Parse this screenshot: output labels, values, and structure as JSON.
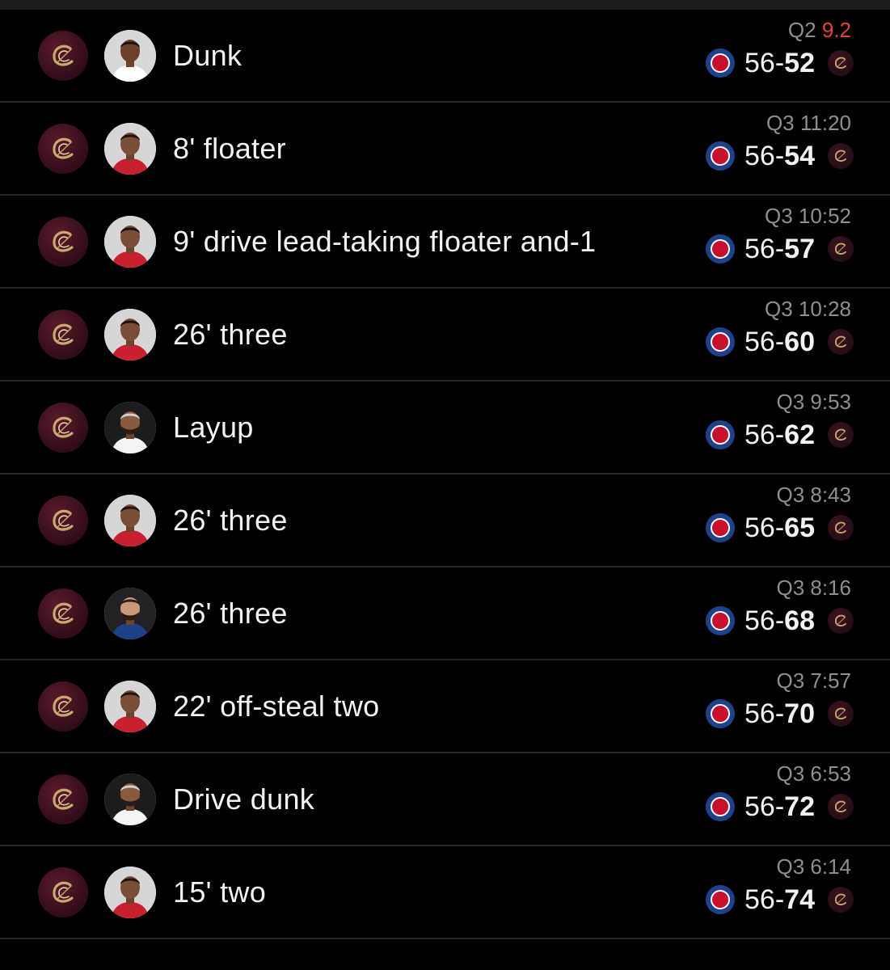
{
  "plays": [
    {
      "team_icon": "cavaliers-logo",
      "player_avatar": "player-a",
      "description": "Dunk",
      "quarter": "Q2",
      "time": "9.2",
      "time_alert": true,
      "score_home": "56",
      "separator": "-",
      "score_away": "52"
    },
    {
      "team_icon": "cavaliers-logo",
      "player_avatar": "player-b",
      "description": "8' floater",
      "quarter": "Q3",
      "time": "11:20",
      "time_alert": false,
      "score_home": "56",
      "separator": "-",
      "score_away": "54"
    },
    {
      "team_icon": "cavaliers-logo",
      "player_avatar": "player-b",
      "description": "9' drive lead-taking floater and-1",
      "quarter": "Q3",
      "time": "10:52",
      "time_alert": false,
      "score_home": "56",
      "separator": "-",
      "score_away": "57"
    },
    {
      "team_icon": "cavaliers-logo",
      "player_avatar": "player-b",
      "description": "26' three",
      "quarter": "Q3",
      "time": "10:28",
      "time_alert": false,
      "score_home": "56",
      "separator": "-",
      "score_away": "60"
    },
    {
      "team_icon": "cavaliers-logo",
      "player_avatar": "player-c",
      "description": "Layup",
      "quarter": "Q3",
      "time": "9:53",
      "time_alert": false,
      "score_home": "56",
      "separator": "-",
      "score_away": "62"
    },
    {
      "team_icon": "cavaliers-logo",
      "player_avatar": "player-b",
      "description": "26' three",
      "quarter": "Q3",
      "time": "8:43",
      "time_alert": false,
      "score_home": "56",
      "separator": "-",
      "score_away": "65"
    },
    {
      "team_icon": "cavaliers-logo",
      "player_avatar": "player-d",
      "description": "26' three",
      "quarter": "Q3",
      "time": "8:16",
      "time_alert": false,
      "score_home": "56",
      "separator": "-",
      "score_away": "68"
    },
    {
      "team_icon": "cavaliers-logo",
      "player_avatar": "player-b",
      "description": "22' off-steal two",
      "quarter": "Q3",
      "time": "7:57",
      "time_alert": false,
      "score_home": "56",
      "separator": "-",
      "score_away": "70"
    },
    {
      "team_icon": "cavaliers-logo",
      "player_avatar": "player-c",
      "description": "Drive dunk",
      "quarter": "Q3",
      "time": "6:53",
      "time_alert": false,
      "score_home": "56",
      "separator": "-",
      "score_away": "72"
    },
    {
      "team_icon": "cavaliers-logo",
      "player_avatar": "player-b",
      "description": "15' two",
      "quarter": "Q3",
      "time": "6:14",
      "time_alert": false,
      "score_home": "56",
      "separator": "-",
      "score_away": "74"
    }
  ],
  "colors": {
    "background": "#000000",
    "row_divider": "#262628",
    "text_primary": "#f2f2f2",
    "text_secondary": "#8e8e93",
    "clock_alert": "#e0443e",
    "cavs_wine": "#5a1a2c",
    "cavs_gold": "#c9a96a",
    "pistons_blue": "#1d428a",
    "pistons_red": "#c8102e"
  }
}
